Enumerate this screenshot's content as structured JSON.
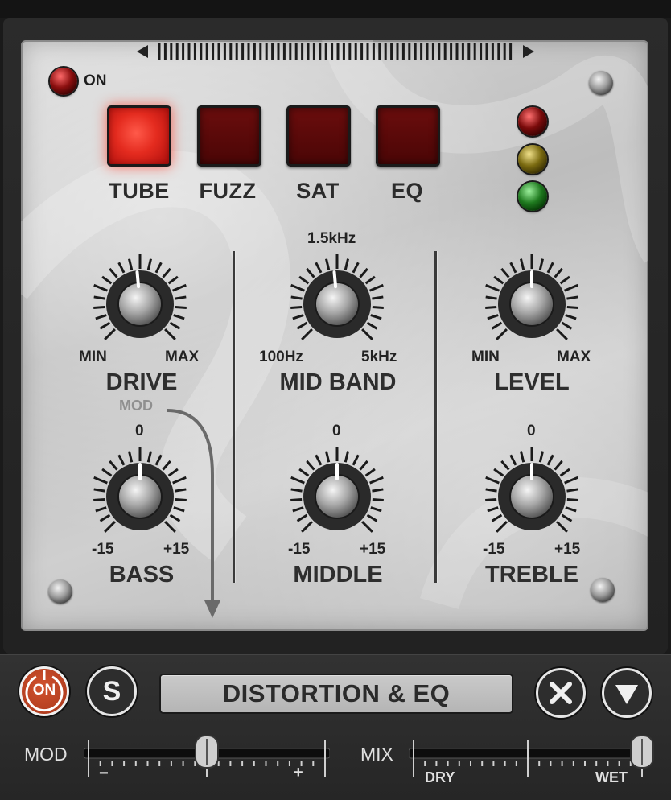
{
  "plugin": {
    "power_label": "ON",
    "modes": [
      {
        "label": "TUBE",
        "active": true
      },
      {
        "label": "FUZZ",
        "active": false
      },
      {
        "label": "SAT",
        "active": false
      },
      {
        "label": "EQ",
        "active": false
      }
    ],
    "status_leds": [
      "red",
      "yellow",
      "green"
    ]
  },
  "knobs": {
    "drive": {
      "title": "DRIVE",
      "min_label": "MIN",
      "max_label": "MAX"
    },
    "mid_band": {
      "title": "MID BAND",
      "top_label": "1.5kHz",
      "min_label": "100Hz",
      "max_label": "5kHz"
    },
    "level": {
      "title": "LEVEL",
      "min_label": "MIN",
      "max_label": "MAX"
    },
    "bass": {
      "title": "BASS",
      "top_label": "0",
      "min_label": "-15",
      "max_label": "+15"
    },
    "middle": {
      "title": "MIDDLE",
      "top_label": "0",
      "min_label": "-15",
      "max_label": "+15"
    },
    "treble": {
      "title": "TREBLE",
      "top_label": "0",
      "min_label": "-15",
      "max_label": "+15"
    }
  },
  "mod_label": "MOD",
  "footer": {
    "on_label": "ON",
    "solo_label": "S",
    "preset_name": "DISTORTION & EQ",
    "mod_slider": {
      "label": "MOD",
      "min": "−",
      "max": "+",
      "value": 0.5
    },
    "mix_slider": {
      "label": "MIX",
      "min": "DRY",
      "max": "WET",
      "value": 1.0
    }
  },
  "colors": {
    "active_mode": "#e42b1f",
    "inactive_mode": "#5a0909",
    "on_button": "#c0441f"
  }
}
